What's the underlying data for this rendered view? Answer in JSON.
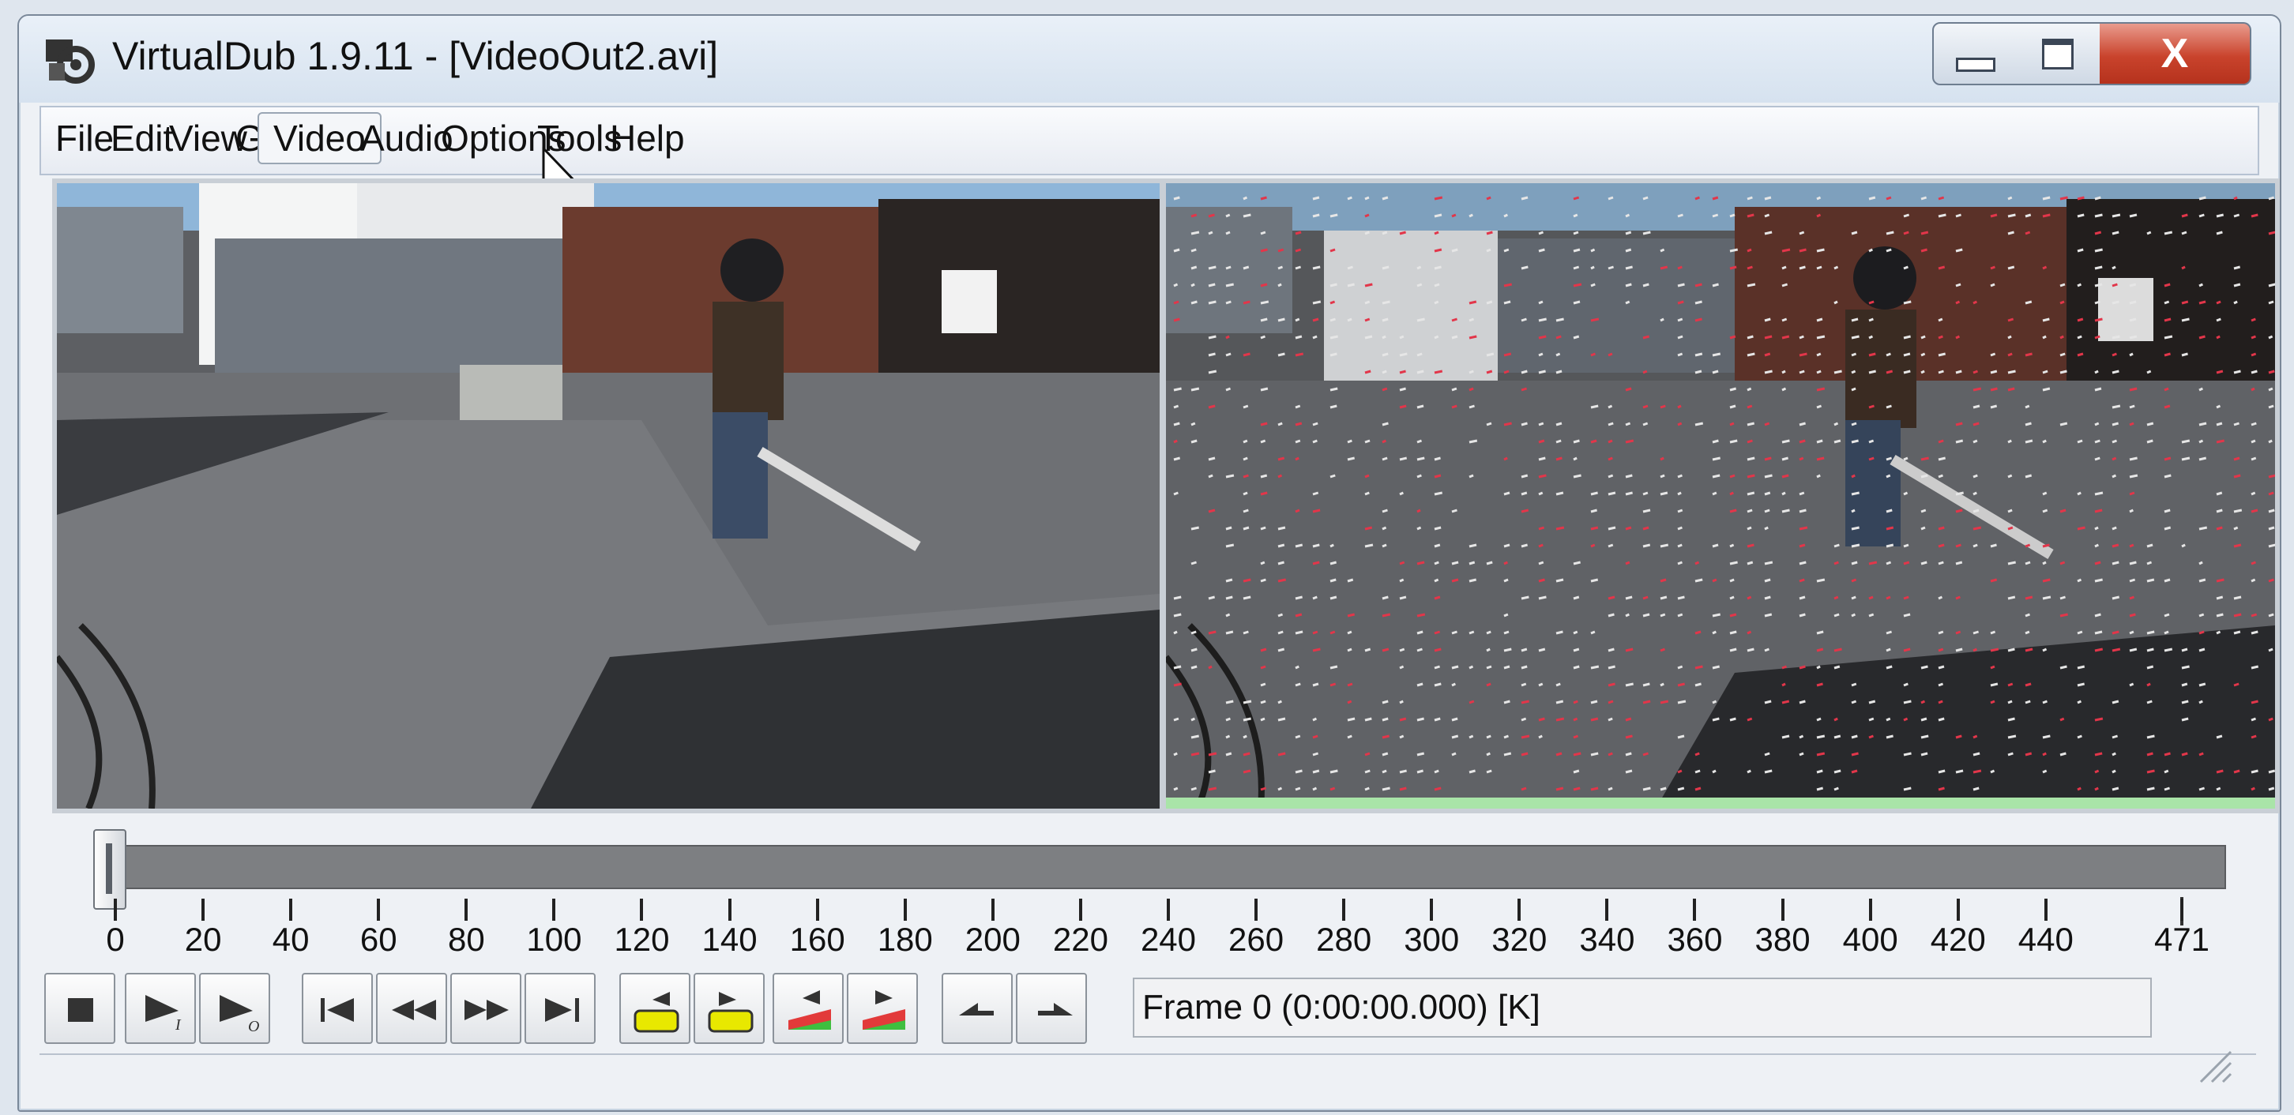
{
  "window": {
    "title": "VirtualDub 1.9.11 - [VideoOut2.avi]",
    "controls": {
      "minimize": "minimize-icon",
      "maximize": "maximize-icon",
      "close": "X"
    }
  },
  "menu": {
    "items": [
      "File",
      "Edit",
      "View",
      "Go",
      "Video",
      "Audio",
      "Options",
      "Tools",
      "Help"
    ],
    "active": "Video"
  },
  "panes": {
    "input": {
      "content": "input video frame"
    },
    "output": {
      "content": "output video frame with motion vectors"
    }
  },
  "timeline": {
    "ticks": [
      "0",
      "20",
      "40",
      "60",
      "80",
      "100",
      "120",
      "140",
      "160",
      "180",
      "200",
      "220",
      "240",
      "260",
      "280",
      "300",
      "320",
      "340",
      "360",
      "380",
      "400",
      "420",
      "440",
      "471"
    ],
    "position": 0,
    "total": 471
  },
  "toolbar": {
    "buttons": [
      "stop-icon",
      "play-input-icon",
      "play-output-icon",
      "go-start-icon",
      "prev-keyframe-icon",
      "next-keyframe-icon",
      "go-end-icon",
      "scene-back-icon",
      "scene-forward-icon",
      "mark-in-icon",
      "mark-out-icon",
      "prev-frame-icon",
      "next-frame-icon"
    ],
    "frame_status": "Frame 0 (0:00:00.000) [K]"
  },
  "colors": {
    "title_bar": "#d6e2ef",
    "close_button": "#c9432c",
    "timeline_track": "#7d7f82",
    "keyframe_green": "#a9e4a8"
  }
}
